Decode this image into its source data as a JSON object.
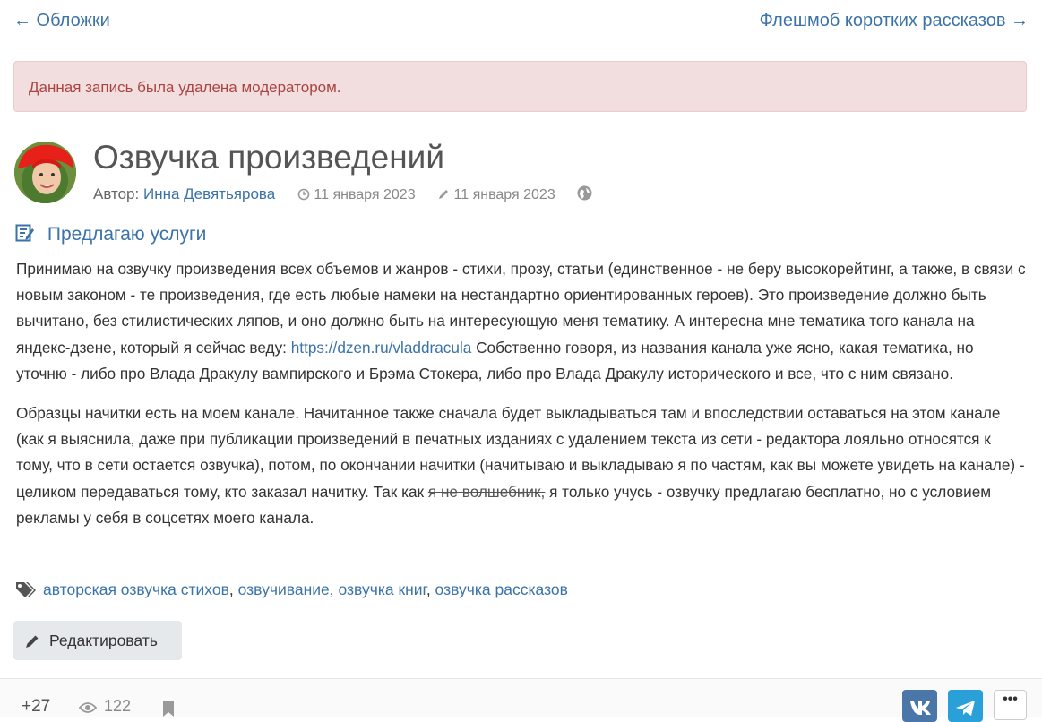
{
  "nav": {
    "prev_label": "← Обложки",
    "next_label": "Флешмоб коротких рассказов →"
  },
  "alert": {
    "text": "Данная запись была удалена модератором."
  },
  "post": {
    "title": "Озвучка произведений",
    "author_label": "Автор:",
    "author_name": "Инна Девятьярова",
    "created_date": "11 января 2023",
    "edited_date": "11 января 2023",
    "category": "Предлагаю услуги",
    "paragraph1_before_link": "Принимаю на озвучку произведения всех объемов и жанров - стихи, прозу, статьи (единственное - не беру высокорейтинг, а также, в связи с новым законом - те произведения, где есть любые намеки на нестандартно ориентированных героев). Это произведение должно быть вычитано, без стилистических ляпов, и оно должно быть на интересующую меня тематику. А интересна мне тематика того канала на яндекс-дзене, который я сейчас веду: ",
    "paragraph1_link": "https://dzen.ru/vladdracula",
    "paragraph1_after_link": " Собственно говоря, из названия канала уже ясно, какая тематика, но уточню - либо про Влада Дракулу вампирского и Брэма Стокера, либо про Влада Дракулу исторического и все, что с ним связано.",
    "paragraph2_before_strike": "Образцы начитки есть на моем канале. Начитанное также сначала будет выкладываться там и впоследствии оставаться на этом канале (как я выяснила, даже при публикации произведений в печатных изданиях с удалением текста из сети - редактора лояльно относятся к тому, что в сети остается озвучка), потом, по окончании начитки (начитываю и выкладываю я по частям, как вы можете увидеть на канале) - целиком передаваться тому, кто заказал начитку. Так как ",
    "paragraph2_strike": "я не волшебник,",
    "paragraph2_after_strike": " я только учусь - озвучку предлагаю бесплатно, но с условием рекламы у себя в соцсетях моего канала.",
    "tags": [
      "авторская озвучка стихов",
      "озвучивание",
      "озвучка книг",
      "озвучка рассказов"
    ],
    "tag_separator": ", ",
    "edit_label": "Редактировать"
  },
  "footer": {
    "rating": "+27",
    "views": "122"
  },
  "icons": {
    "clock": "clock-icon",
    "pencil": "pencil-icon",
    "globe": "globe-icon",
    "category": "edit-note-icon",
    "tags": "tags-icon",
    "eye": "eye-icon",
    "bookmark": "bookmark-icon",
    "vk": "vk-icon",
    "telegram": "telegram-icon",
    "more": "ellipsis-icon"
  },
  "colors": {
    "link": "#3b73a8",
    "alert_bg": "#f2dede",
    "alert_text": "#a94442",
    "vk": "#4a76a8",
    "telegram": "#2aa0d9"
  }
}
